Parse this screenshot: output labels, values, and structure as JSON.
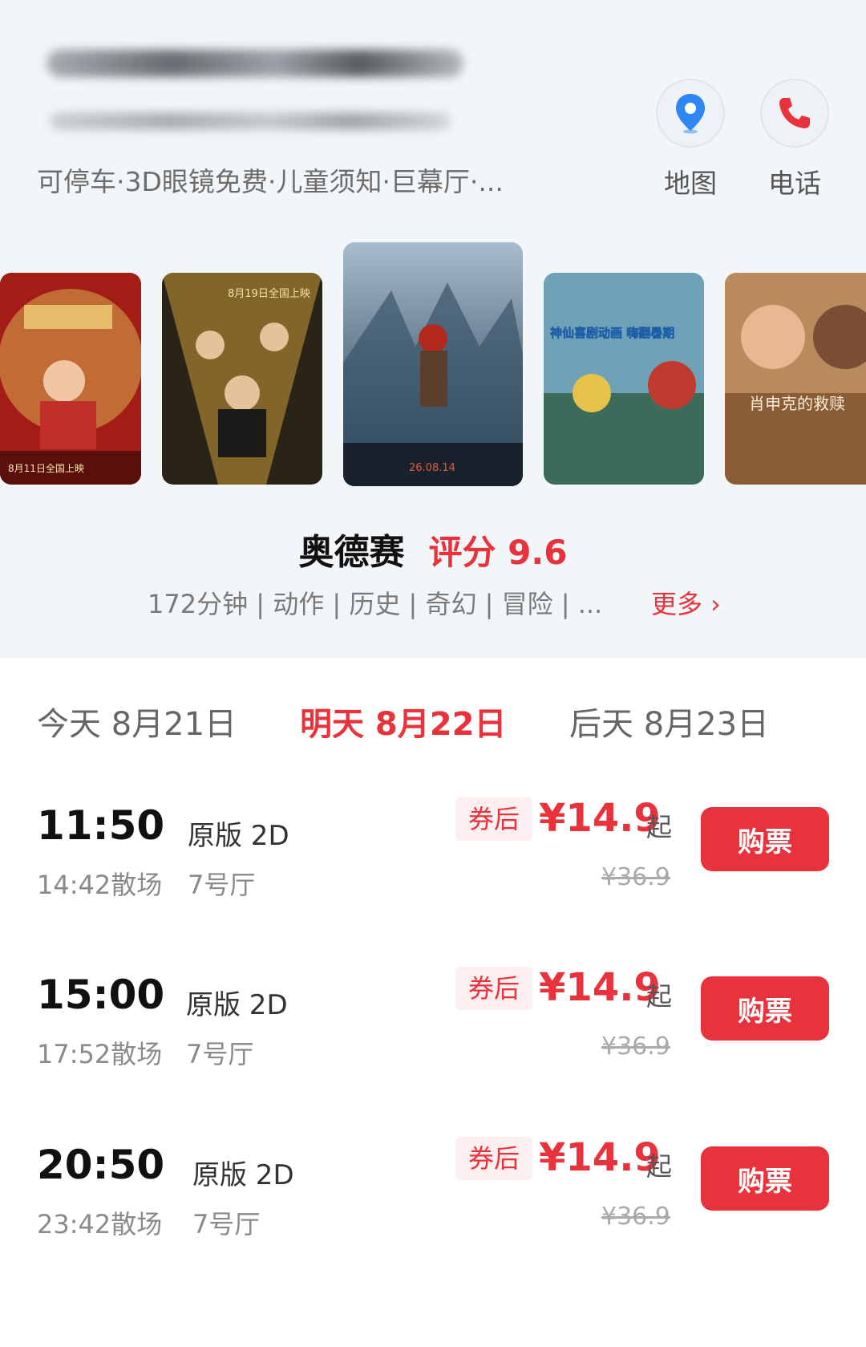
{
  "cinema": {
    "facilities": "可停车·3D眼镜免费·儿童须知·巨幕厅·...",
    "map_label": "地图",
    "phone_label": "电话"
  },
  "posters": [
    {
      "id": "p1",
      "caption": "8月11日全国上映"
    },
    {
      "id": "p2",
      "caption": "8月19日全国上映"
    },
    {
      "id": "p3",
      "caption": "26.08.14"
    },
    {
      "id": "p4",
      "caption": "神仙喜剧动画 嗨翻暑期"
    },
    {
      "id": "p5",
      "caption": "肖申克的救赎"
    }
  ],
  "movie": {
    "name": "奥德赛",
    "score": "评分 9.6",
    "meta": "172分钟 | 动作 | 历史 | 奇幻 | 冒险 | ...",
    "more": "更多 ›"
  },
  "dates": [
    {
      "label": "今天 8月21日",
      "active": false
    },
    {
      "label": "明天 8月22日",
      "active": true
    },
    {
      "label": "后天 8月23日",
      "active": false
    }
  ],
  "showtimes": [
    {
      "start": "11:50",
      "format": "原版 2D",
      "end": "14:42散场",
      "hall": "7号厅",
      "coupon": "券后",
      "price": "¥14.9",
      "suffix": "起",
      "original": "¥36.9",
      "buy": "购票"
    },
    {
      "start": "15:00",
      "format": "原版 2D",
      "end": "17:52散场",
      "hall": "7号厅",
      "coupon": "券后",
      "price": "¥14.9",
      "suffix": "起",
      "original": "¥36.9",
      "buy": "购票"
    },
    {
      "start": "20:50",
      "format": "原版 2D",
      "end": "23:42散场",
      "hall": "7号厅",
      "coupon": "券后",
      "price": "¥14.9",
      "suffix": "起",
      "original": "¥36.9",
      "buy": "购票"
    }
  ],
  "colors": {
    "accent": "#e8323c",
    "header_bg": "#f3f6f9",
    "map_icon": "#2f87f5"
  }
}
